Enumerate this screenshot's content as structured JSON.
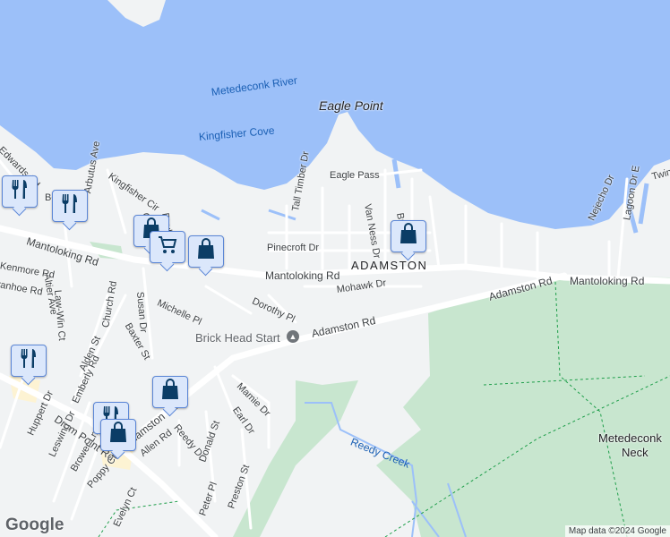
{
  "map": {
    "colors": {
      "water": "#9cc0f9",
      "land": "#f1f3f4",
      "park": "#c8e6cf",
      "road": "#ffffff",
      "pin": "#0b3d66"
    },
    "water_labels": [
      "Metedeconk River",
      "Kingfisher Cove",
      "Reedy Creek"
    ],
    "place_labels": {
      "eagle_point": "Eagle Point",
      "adamston": "ADAMSTON",
      "neck": "Metedeconk\nNeck",
      "neck_line1": "Metedeconk",
      "neck_line2": "Neck",
      "poi": "Brick Head Start"
    },
    "roads": [
      "Mantoloking Rd",
      "Mantoloking Rd",
      "Mantoloking Rd",
      "Adamston Rd",
      "Adamston Rd",
      "Adamston Rd",
      "Drum Point Rd",
      "Edwards Rd",
      "Kingfisher Cir",
      "Arbutus Ave",
      "Altier Ave",
      "Law-Win Ct",
      "Kenmore Rd",
      "Ivanhoe Rd",
      "Church Rd",
      "Susan Dr",
      "Michelle Pl",
      "Baxter St",
      "Alden St",
      "Emberly Rd",
      "Huppert Dr",
      "Leswing Dr",
      "Brower Ln",
      "Poppy Ct",
      "Allen Rd",
      "Reedy Dr",
      "Evelyn Ct",
      "Donald St",
      "Peter Pl",
      "Preston St",
      "Mamie Dr",
      "Earl Dr",
      "Dorothy Pl",
      "Mohawk Dr",
      "Pinecroft Dr",
      "Tall Timber Dr",
      "Eagle Pass",
      "Van Ness Dr",
      "Nejecho Dr",
      "Lagoon Dr E",
      "Twin",
      "Baybe",
      "Bo",
      "Ca",
      "Bre"
    ],
    "pins": [
      {
        "type": "restaurant",
        "icon": "fork-knife-icon"
      },
      {
        "type": "restaurant",
        "icon": "fork-knife-icon"
      },
      {
        "type": "shopping",
        "icon": "shopping-bag-icon"
      },
      {
        "type": "grocery",
        "icon": "shopping-cart-icon"
      },
      {
        "type": "shopping",
        "icon": "shopping-bag-icon"
      },
      {
        "type": "shopping",
        "icon": "shopping-bag-icon"
      },
      {
        "type": "restaurant",
        "icon": "fork-knife-icon"
      },
      {
        "type": "shopping",
        "icon": "shopping-bag-icon"
      },
      {
        "type": "restaurant",
        "icon": "fork-knife-icon"
      },
      {
        "type": "shopping",
        "icon": "shopping-bag-icon"
      }
    ],
    "logo": "Google",
    "attribution": "Map data ©2024 Google"
  }
}
